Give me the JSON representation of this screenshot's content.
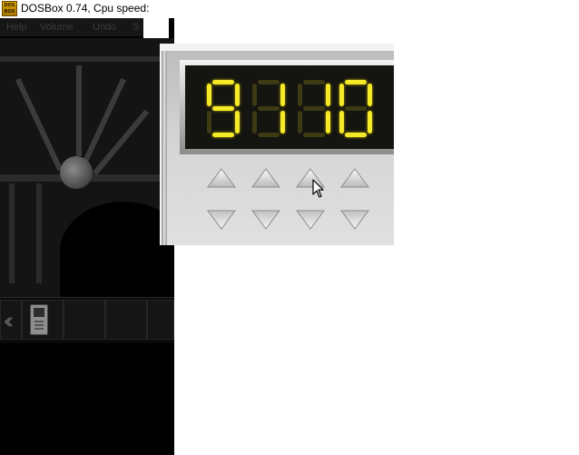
{
  "window": {
    "icon_text": "DOS BOX",
    "title": "DOSBox 0.74, Cpu speed:"
  },
  "menu": {
    "items": [
      "Help",
      "Volume",
      "Undo",
      "S"
    ]
  },
  "keypad": {
    "digits": [
      9,
      1,
      1,
      0
    ],
    "digit_color_on": "#f6e928",
    "digit_color_off": "#3d3a14",
    "up_buttons": [
      "up-arrow-icon",
      "up-arrow-icon",
      "up-arrow-icon",
      "up-arrow-icon"
    ],
    "down_buttons": [
      "down-arrow-icon",
      "down-arrow-icon",
      "down-arrow-icon",
      "down-arrow-icon"
    ]
  }
}
